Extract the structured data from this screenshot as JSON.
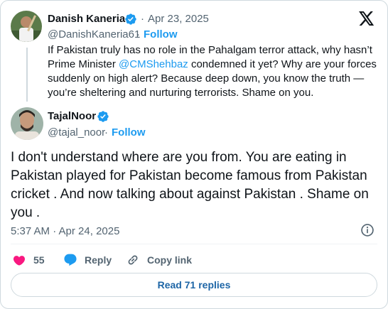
{
  "quoted_tweet": {
    "name": "Danish Kaneria",
    "dot": "·",
    "date": "Apr 23, 2025",
    "handle": "@DanishKaneria61",
    "handle_dot": "·",
    "follow": "Follow",
    "text_before": "If Pakistan truly has no role in the Pahalgam terror attack, why hasn’t Prime Minister ",
    "mention": "@CMShehbaz",
    "text_after": " condemned it yet? Why are your forces suddenly on high alert? Because deep down, you know the truth — you’re sheltering and nurturing terrorists. Shame on you."
  },
  "reply_tweet": {
    "name": "TajalNoor",
    "handle": "@tajal_noor",
    "handle_dot": "·",
    "follow": "Follow",
    "text": "I don't understand where are you from.  You are eating in Pakistan played for Pakistan become famous from Pakistan cricket . And now talking about against Pakistan . Shame on you .",
    "timestamp": "5:37 AM · Apr 24, 2025"
  },
  "actions": {
    "like_count": "55",
    "reply_label": "Reply",
    "copy_label": "Copy link"
  },
  "read_replies": "Read 71 replies",
  "icons": {
    "verified": "verified-badge-icon",
    "brand": "x-logo-icon",
    "info": "info-icon",
    "like": "heart-icon",
    "reply": "reply-bubble-icon",
    "copy": "link-icon"
  },
  "colors": {
    "accent": "#1d9bf0",
    "like": "#f91880",
    "muted": "#536471",
    "text": "#0f1419"
  }
}
